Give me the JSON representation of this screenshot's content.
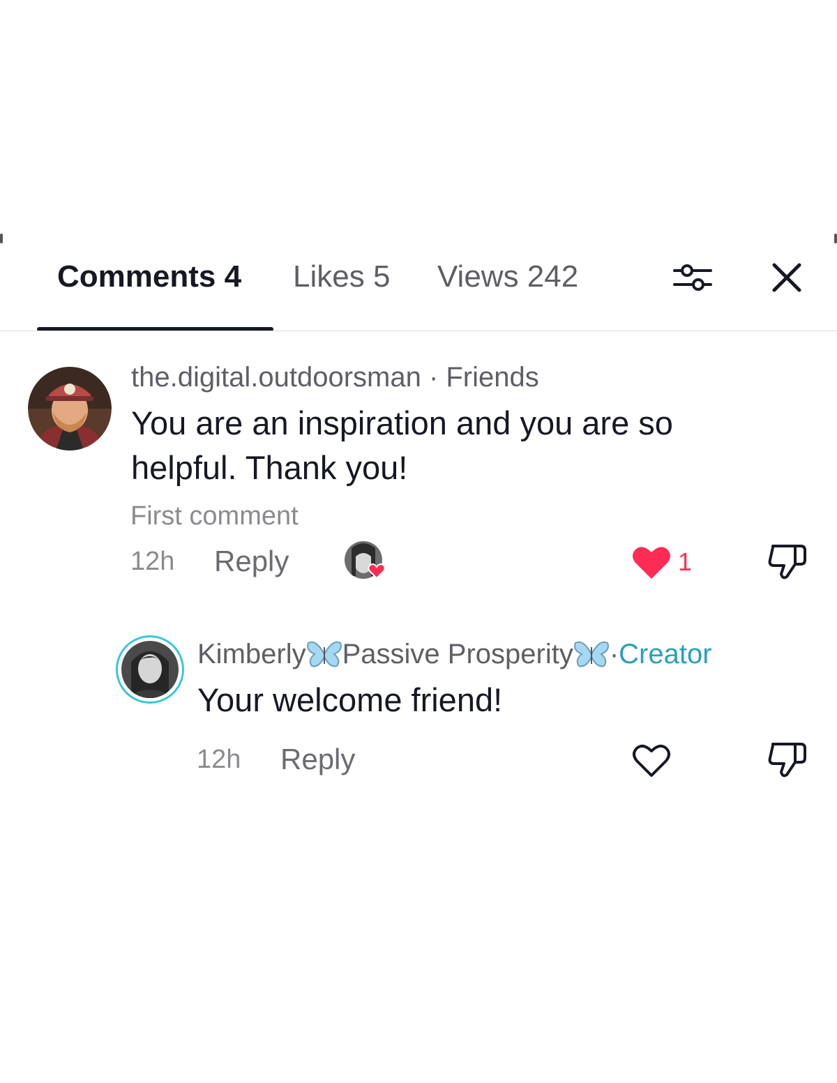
{
  "tabs": [
    {
      "label": "Comments 4"
    },
    {
      "label": "Likes 5"
    },
    {
      "label": "Views 242"
    }
  ],
  "comments": [
    {
      "username": "the.digital.outdoorsman",
      "relation_sep": " · ",
      "relation": "Friends",
      "text": "You are an inspiration and you are so helpful. Thank you!",
      "note": "First comment",
      "time": "12h",
      "reply_label": "Reply",
      "likes": "1",
      "liked": true
    },
    {
      "username_part1": "Kimberly",
      "username_part2": "Passive Prosperity",
      "relation_sep": " · ",
      "relation": "Creator",
      "text": "Your welcome friend!",
      "time": "12h",
      "reply_label": "Reply",
      "liked": false
    }
  ],
  "colors": {
    "accent_creator": "#2b9fb8",
    "like_red": "#fe2c55",
    "text_primary": "#161823",
    "text_secondary": "#8a8b91"
  },
  "icons": [
    "filter-sliders-icon",
    "close-icon",
    "heart-filled-icon",
    "heart-outline-icon",
    "dislike-icon",
    "butterfly-icon"
  ]
}
